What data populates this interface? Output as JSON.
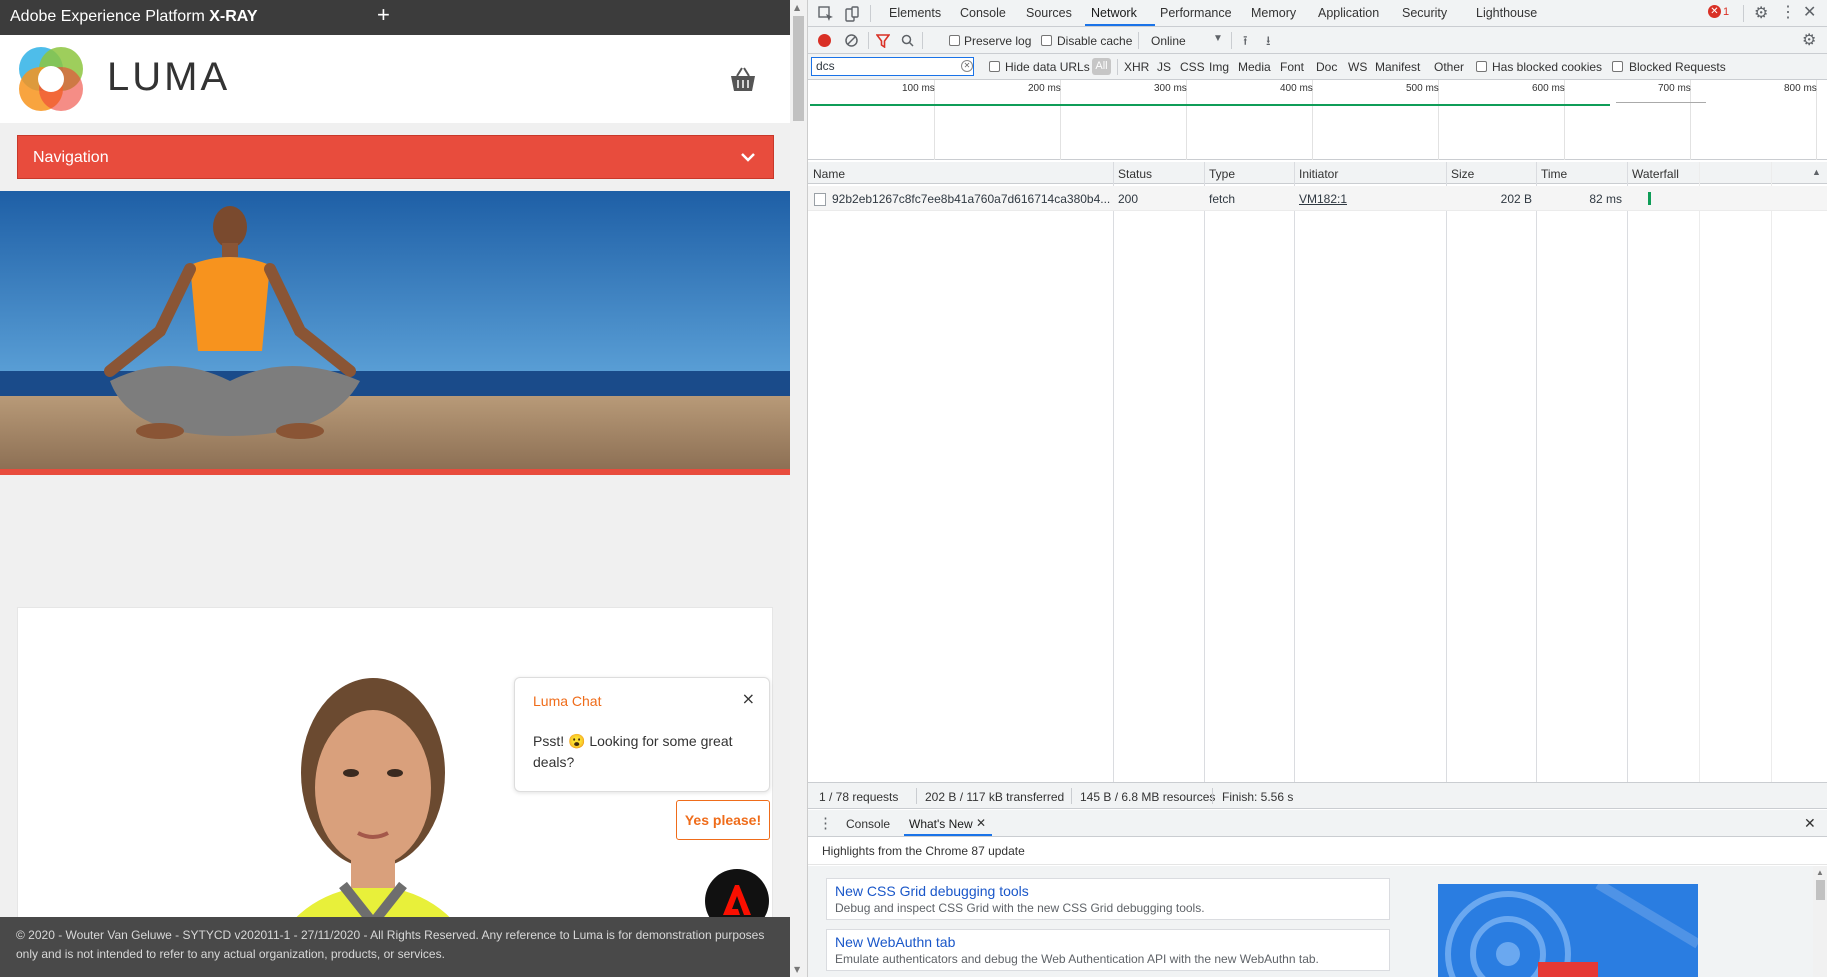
{
  "xray": {
    "title_prefix": "Adobe Experience Platform",
    "title_strong": "X-RAY",
    "new_tab": "+"
  },
  "luma": {
    "brand": "LUMA",
    "navigation_label": "Navigation",
    "chat": {
      "title": "Luma Chat",
      "close": "×",
      "message": "Psst! 😮 Looking for some great deals?",
      "cta": "Yes please!"
    },
    "footer": "© 2020 - Wouter Van Geluwe - SYTYCD v202011-1 - 27/11/2020 - All Rights Reserved. Any reference to Luma is for demonstration purposes only and is not intended to refer to any actual organization, products, or services."
  },
  "devtools": {
    "tabs": [
      "Elements",
      "Console",
      "Sources",
      "Network",
      "Performance",
      "Memory",
      "Application",
      "Security",
      "Lighthouse"
    ],
    "active_tab": "Network",
    "error_count": "1",
    "toolbar": {
      "preserve_log": "Preserve log",
      "disable_cache": "Disable cache",
      "throttling": "Online"
    },
    "filter": {
      "value": "dcs",
      "hide_data_urls": "Hide data URLs",
      "types": [
        "All",
        "XHR",
        "JS",
        "CSS",
        "Img",
        "Media",
        "Font",
        "Doc",
        "WS",
        "Manifest",
        "Other"
      ],
      "has_blocked_cookies": "Has blocked cookies",
      "blocked_requests": "Blocked Requests"
    },
    "timeline_labels": [
      "100 ms",
      "200 ms",
      "300 ms",
      "400 ms",
      "500 ms",
      "600 ms",
      "700 ms",
      "800 ms"
    ],
    "columns": [
      "Name",
      "Status",
      "Type",
      "Initiator",
      "Size",
      "Time",
      "Waterfall"
    ],
    "rows": [
      {
        "name": "92b2eb1267c8fc7ee8b41a760a7d616714ca380b4...",
        "status": "200",
        "type": "fetch",
        "initiator": "VM182:1",
        "size": "202 B",
        "time": "82 ms"
      }
    ],
    "summary": {
      "requests": "1 / 78 requests",
      "transferred": "202 B / 117 kB transferred",
      "resources": "145 B / 6.8 MB resources",
      "finish": "Finish: 5.56 s"
    },
    "drawer": {
      "tabs": [
        "Console",
        "What's New"
      ],
      "highlights": "Highlights from the Chrome 87 update",
      "items": [
        {
          "title": "New CSS Grid debugging tools",
          "desc": "Debug and inspect CSS Grid with the new CSS Grid debugging tools."
        },
        {
          "title": "New WebAuthn tab",
          "desc": "Emulate authenticators and debug the Web Authentication API with the new WebAuthn tab."
        }
      ]
    }
  },
  "colors": {
    "luma_red": "#e84c3d",
    "chat_orange": "#ef6c1a",
    "devtools_blue": "#1a73e8",
    "waterfall_green": "#0f9d58"
  }
}
